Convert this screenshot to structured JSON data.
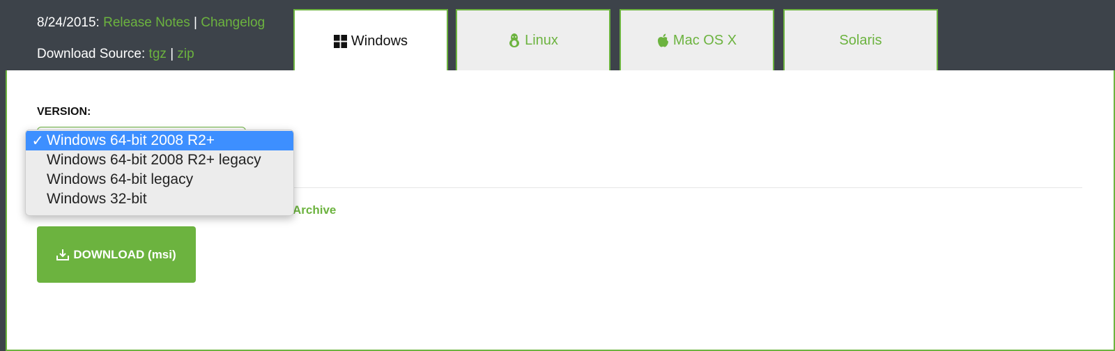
{
  "header": {
    "date": "8/24/2015:",
    "release_notes": "Release Notes",
    "sep1": "|",
    "changelog": "Changelog",
    "source_label": "Download Source:",
    "tgz": "tgz",
    "sep2": "|",
    "zip": "zip"
  },
  "tabs": [
    {
      "label": "Windows",
      "icon": "windows-icon",
      "active": true
    },
    {
      "label": "Linux",
      "icon": "linux-icon",
      "active": false
    },
    {
      "label": "Mac OS X",
      "icon": "apple-icon",
      "active": false
    },
    {
      "label": "Solaris",
      "icon": "",
      "active": false
    }
  ],
  "version": {
    "label": "VERSION:",
    "options": [
      {
        "label": "Windows 64-bit 2008 R2+",
        "selected": true,
        "check": "✓"
      },
      {
        "label": "Windows 64-bit 2008 R2+ legacy",
        "selected": false,
        "check": ""
      },
      {
        "label": "Windows 64-bit legacy",
        "selected": false,
        "check": ""
      },
      {
        "label": "Windows 32-bit",
        "selected": false,
        "check": ""
      }
    ]
  },
  "archive_link": "Archive",
  "download": {
    "label": "DOWNLOAD (msi)",
    "icon": "download-icon"
  },
  "colors": {
    "header_bg": "#3d434a",
    "accent": "#6cb33f",
    "selected_option": "#3d8fff",
    "tab_bg": "#eeeeee"
  }
}
